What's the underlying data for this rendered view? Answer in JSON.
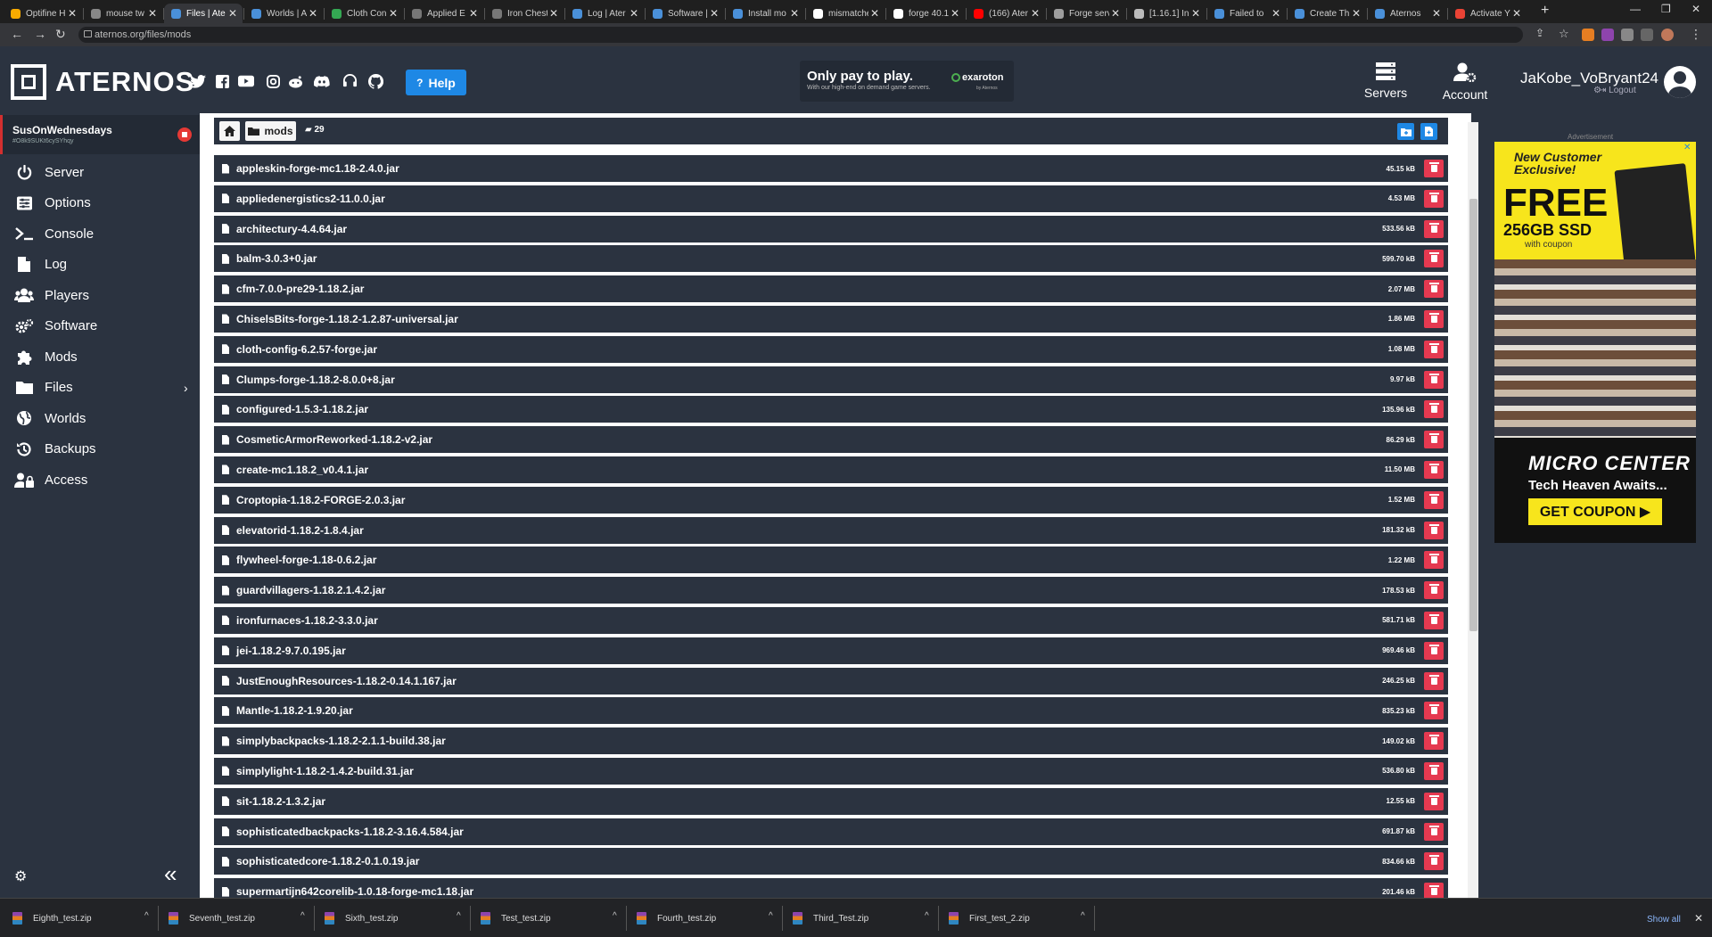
{
  "browser": {
    "tabs": [
      {
        "title": "Optifine H",
        "color": "#f9ab00"
      },
      {
        "title": "mouse tw",
        "color": "#888888"
      },
      {
        "title": "Files | Ate",
        "color": "#4a90d9",
        "active": true
      },
      {
        "title": "Worlds | A",
        "color": "#4a90d9"
      },
      {
        "title": "Cloth Con",
        "color": "#34a853"
      },
      {
        "title": "Applied E",
        "color": "#777777"
      },
      {
        "title": "Iron Chest",
        "color": "#777777"
      },
      {
        "title": "Log | Ater",
        "color": "#4a90d9"
      },
      {
        "title": "Software |",
        "color": "#4a90d9"
      },
      {
        "title": "Install mo",
        "color": "#4a90d9"
      },
      {
        "title": "mismatche",
        "color": "#ffffff"
      },
      {
        "title": "forge 40.1",
        "color": "#ffffff"
      },
      {
        "title": "(166) Ater",
        "color": "#ff0000"
      },
      {
        "title": "Forge serv",
        "color": "#9e9e9e"
      },
      {
        "title": "[1.16.1] Ini",
        "color": "#bbbbbb"
      },
      {
        "title": "Failed to",
        "color": "#4a90d9"
      },
      {
        "title": "Create Th",
        "color": "#4a90d9"
      },
      {
        "title": "Aternos",
        "color": "#4a90d9"
      },
      {
        "title": "Activate Y",
        "color": "#ea4335"
      }
    ],
    "tab_close": "✕",
    "new_tab": "+",
    "url": "aternos.org/files/mods"
  },
  "header": {
    "logo_text": "ATERNOS",
    "help_label": "Help",
    "ad_banner": {
      "title": "Only pay to play.",
      "subtitle": "With our high-end on demand game servers.",
      "brand": "exaroton",
      "brand_by": "by Aternos"
    },
    "servers_label": "Servers",
    "account_label": "Account",
    "username": "JaKobe_VoBryant24",
    "logout_label": "Logout"
  },
  "sidebar": {
    "server_name": "SusOnWednesdays",
    "server_id": "#O8k9SUKt6cySYhqy",
    "items": [
      {
        "label": "Server",
        "icon": "power-icon"
      },
      {
        "label": "Options",
        "icon": "sliders-icon"
      },
      {
        "label": "Console",
        "icon": "terminal-icon"
      },
      {
        "label": "Log",
        "icon": "file-icon"
      },
      {
        "label": "Players",
        "icon": "users-icon"
      },
      {
        "label": "Software",
        "icon": "cogs-icon"
      },
      {
        "label": "Mods",
        "icon": "puzzle-icon"
      },
      {
        "label": "Files",
        "icon": "folder-icon"
      },
      {
        "label": "Worlds",
        "icon": "globe-icon"
      },
      {
        "label": "Backups",
        "icon": "history-icon"
      },
      {
        "label": "Access",
        "icon": "user-lock-icon"
      }
    ],
    "collapse_label": "«"
  },
  "toolbar": {
    "current_folder": "mods",
    "item_count": "29"
  },
  "files": [
    {
      "name": "appleskin-forge-mc1.18-2.4.0.jar",
      "size": "45.15 kB"
    },
    {
      "name": "appliedenergistics2-11.0.0.jar",
      "size": "4.53 MB"
    },
    {
      "name": "architectury-4.4.64.jar",
      "size": "533.56 kB"
    },
    {
      "name": "balm-3.0.3+0.jar",
      "size": "599.70 kB"
    },
    {
      "name": "cfm-7.0.0-pre29-1.18.2.jar",
      "size": "2.07 MB"
    },
    {
      "name": "ChiselsBits-forge-1.18.2-1.2.87-universal.jar",
      "size": "1.86 MB"
    },
    {
      "name": "cloth-config-6.2.57-forge.jar",
      "size": "1.08 MB"
    },
    {
      "name": "Clumps-forge-1.18.2-8.0.0+8.jar",
      "size": "9.97 kB"
    },
    {
      "name": "configured-1.5.3-1.18.2.jar",
      "size": "135.96 kB"
    },
    {
      "name": "CosmeticArmorReworked-1.18.2-v2.jar",
      "size": "86.29 kB"
    },
    {
      "name": "create-mc1.18.2_v0.4.1.jar",
      "size": "11.50 MB"
    },
    {
      "name": "Croptopia-1.18.2-FORGE-2.0.3.jar",
      "size": "1.52 MB"
    },
    {
      "name": "elevatorid-1.18.2-1.8.4.jar",
      "size": "181.32 kB"
    },
    {
      "name": "flywheel-forge-1.18-0.6.2.jar",
      "size": "1.22 MB"
    },
    {
      "name": "guardvillagers-1.18.2.1.4.2.jar",
      "size": "178.53 kB"
    },
    {
      "name": "ironfurnaces-1.18.2-3.3.0.jar",
      "size": "581.71 kB"
    },
    {
      "name": "jei-1.18.2-9.7.0.195.jar",
      "size": "969.46 kB"
    },
    {
      "name": "JustEnoughResources-1.18.2-0.14.1.167.jar",
      "size": "246.25 kB"
    },
    {
      "name": "Mantle-1.18.2-1.9.20.jar",
      "size": "835.23 kB"
    },
    {
      "name": "simplybackpacks-1.18.2-2.1.1-build.38.jar",
      "size": "149.02 kB"
    },
    {
      "name": "simplylight-1.18.2-1.4.2-build.31.jar",
      "size": "536.80 kB"
    },
    {
      "name": "sit-1.18.2-1.3.2.jar",
      "size": "12.55 kB"
    },
    {
      "name": "sophisticatedbackpacks-1.18.2-3.16.4.584.jar",
      "size": "691.87 kB"
    },
    {
      "name": "sophisticatedcore-1.18.2-0.1.0.19.jar",
      "size": "834.66 kB"
    },
    {
      "name": "supermartijn642corelib-1.0.18-forge-mc1.18.jar",
      "size": "201.46 kB"
    }
  ],
  "advertisement": {
    "label": "Advertisement",
    "headline": "New Customer Exclusive!",
    "free": "FREE",
    "product": "256GB SSD",
    "with_coupon": "with coupon",
    "brand": "MICRO CENTER",
    "tagline": "Tech Heaven Awaits...",
    "cta": "GET COUPON ▶"
  },
  "downloads": {
    "items": [
      "Eighth_test.zip",
      "Seventh_test.zip",
      "Sixth_test.zip",
      "Test_test.zip",
      "Fourth_test.zip",
      "Third_Test.zip",
      "First_test_2.zip"
    ],
    "show_all": "Show all",
    "close": "✕"
  },
  "colors": {
    "accent": "#1e88e5",
    "danger": "#e53950",
    "panel": "#2b3340"
  }
}
